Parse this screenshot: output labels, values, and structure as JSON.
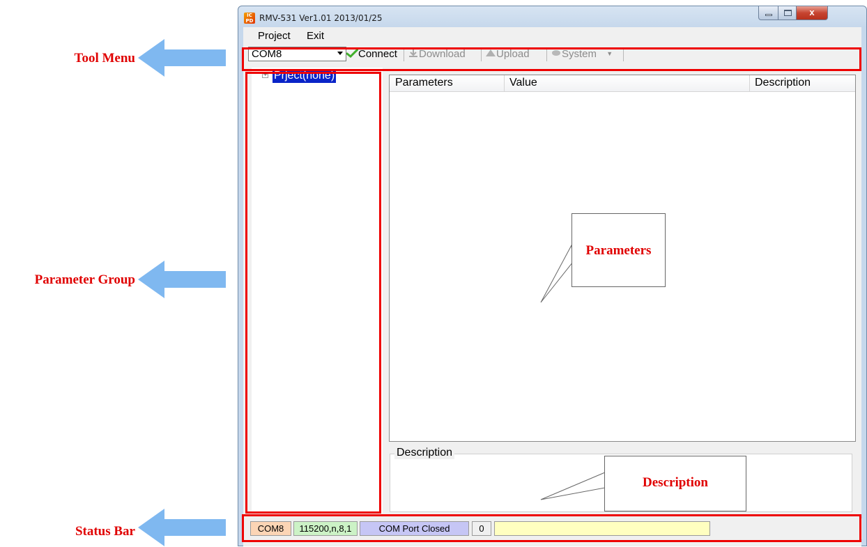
{
  "annotations": {
    "tool_menu": "Tool Menu",
    "parameter_group": "Parameter Group",
    "status_bar": "Status Bar",
    "parameters_callout": "Parameters",
    "description_callout": "Description",
    "annotation_color": "#e00000",
    "arrow_color": "#7fb8f0"
  },
  "window": {
    "title": "RMV-531 Ver1.01 2013/01/25",
    "icon": "app-logo-icon",
    "controls": [
      "minimize-icon",
      "maximize-icon",
      "close-icon"
    ],
    "close_glyph": "x"
  },
  "menu": {
    "project": "Project",
    "exit": "Exit"
  },
  "toolbar": {
    "com_port": "COM8",
    "connect": "Connect",
    "download": "Download",
    "upload": "Upload",
    "system": "System",
    "connect_icon": "checkmark-icon",
    "download_icon": "download-icon",
    "upload_icon": "upload-icon",
    "system_icon": "system-icon"
  },
  "tree": {
    "expander": "+",
    "node_label": "Prject(none)"
  },
  "grid": {
    "columns": [
      "Parameters",
      "Value",
      "Description"
    ],
    "rows": []
  },
  "description_panel": {
    "title": "Description",
    "text": ""
  },
  "status": {
    "port": "COM8",
    "settings": "115200,n,8,1",
    "state": "COM Port Closed",
    "count": "0",
    "message": "",
    "colors": {
      "port": "#fcd5b5",
      "settings": "#ccf2c6",
      "state": "#c6c6f5",
      "count": "#f0f0f0",
      "message": "#ffffc0"
    }
  }
}
